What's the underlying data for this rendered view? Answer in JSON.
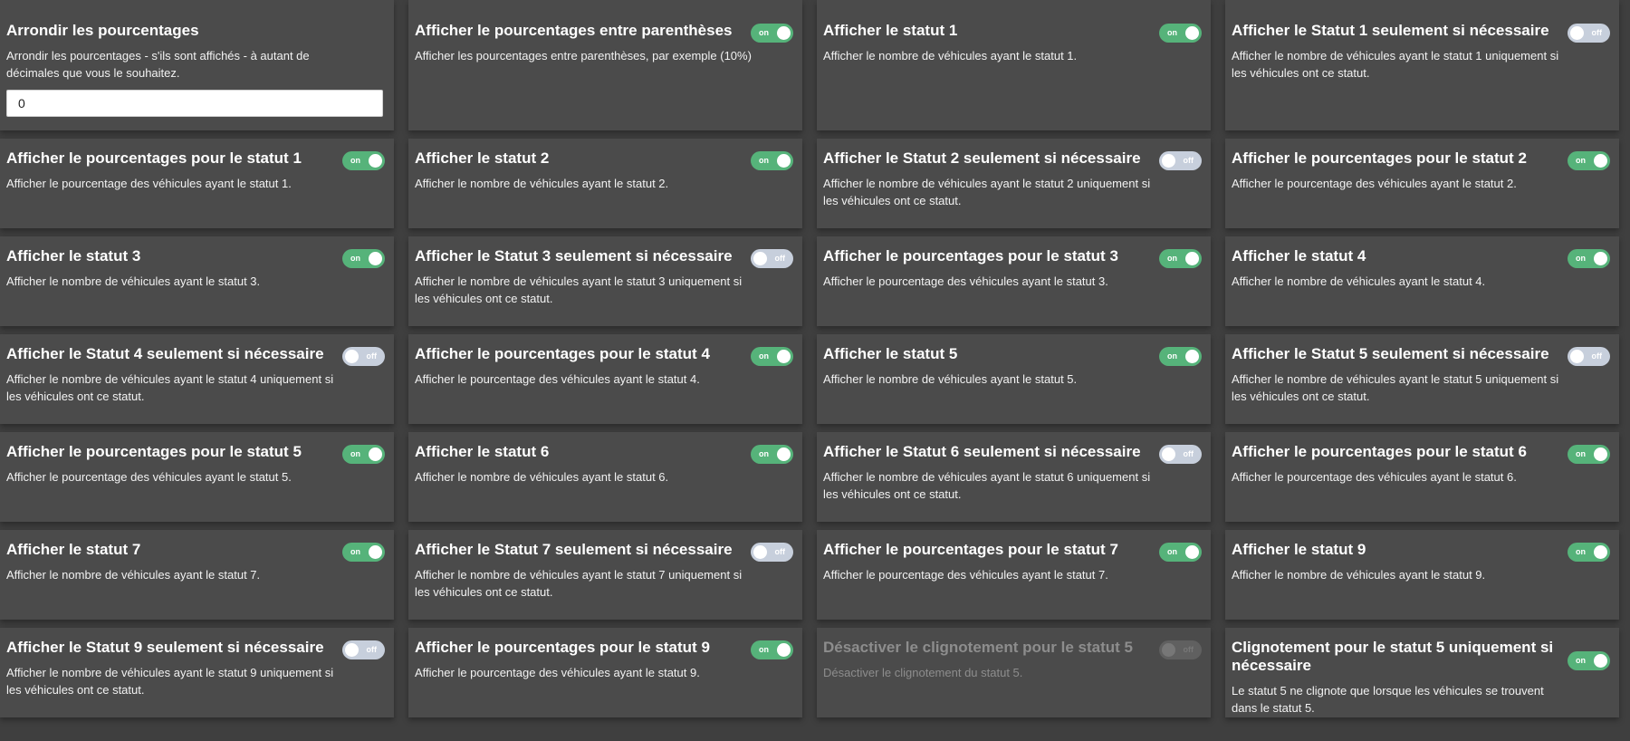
{
  "settings": [
    {
      "title": "Arrondir les pourcentages",
      "desc": "Arrondir les pourcentages - s'ils sont affichés - à autant de décimales que vous le souhaitez.",
      "input_value": "0"
    },
    {
      "title": "Afficher le pourcentages entre parenthèses",
      "desc": "Afficher les pourcentages entre parenthèses, par exemple (10%)",
      "toggle": "on"
    },
    {
      "title": "Afficher le statut 1",
      "desc": "Afficher le nombre de véhicules ayant le statut 1.",
      "toggle": "on"
    },
    {
      "title": "Afficher le Statut 1 seulement si nécessaire",
      "desc": "Afficher le nombre de véhicules ayant le statut 1 uniquement si les véhicules ont ce statut.",
      "toggle": "off"
    },
    {
      "title": "Afficher le pourcentages pour le statut 1",
      "desc": "Afficher le pourcentage des véhicules ayant le statut 1.",
      "toggle": "on"
    },
    {
      "title": "Afficher le statut 2",
      "desc": "Afficher le nombre de véhicules ayant le statut 2.",
      "toggle": "on"
    },
    {
      "title": "Afficher le Statut 2 seulement si nécessaire",
      "desc": "Afficher le nombre de véhicules ayant le statut 2 uniquement si les véhicules ont ce statut.",
      "toggle": "off"
    },
    {
      "title": "Afficher le pourcentages pour le statut 2",
      "desc": "Afficher le pourcentage des véhicules ayant le statut 2.",
      "toggle": "on"
    },
    {
      "title": "Afficher le statut 3",
      "desc": "Afficher le nombre de véhicules ayant le statut 3.",
      "toggle": "on"
    },
    {
      "title": "Afficher le Statut 3 seulement si nécessaire",
      "desc": "Afficher le nombre de véhicules ayant le statut 3 uniquement si les véhicules ont ce statut.",
      "toggle": "off"
    },
    {
      "title": "Afficher le pourcentages pour le statut 3",
      "desc": "Afficher le pourcentage des véhicules ayant le statut 3.",
      "toggle": "on"
    },
    {
      "title": "Afficher le statut 4",
      "desc": "Afficher le nombre de véhicules ayant le statut 4.",
      "toggle": "on"
    },
    {
      "title": "Afficher le Statut 4 seulement si nécessaire",
      "desc": "Afficher le nombre de véhicules ayant le statut 4 uniquement si les véhicules ont ce statut.",
      "toggle": "off"
    },
    {
      "title": "Afficher le pourcentages pour le statut 4",
      "desc": "Afficher le pourcentage des véhicules ayant le statut 4.",
      "toggle": "on"
    },
    {
      "title": "Afficher le statut 5",
      "desc": "Afficher le nombre de véhicules ayant le statut 5.",
      "toggle": "on"
    },
    {
      "title": "Afficher le Statut 5 seulement si nécessaire",
      "desc": "Afficher le nombre de véhicules ayant le statut 5 uniquement si les véhicules ont ce statut.",
      "toggle": "off"
    },
    {
      "title": "Afficher le pourcentages pour le statut 5",
      "desc": "Afficher le pourcentage des véhicules ayant le statut 5.",
      "toggle": "on"
    },
    {
      "title": "Afficher le statut 6",
      "desc": "Afficher le nombre de véhicules ayant le statut 6.",
      "toggle": "on"
    },
    {
      "title": "Afficher le Statut 6 seulement si nécessaire",
      "desc": "Afficher le nombre de véhicules ayant le statut 6 uniquement si les véhicules ont ce statut.",
      "toggle": "off"
    },
    {
      "title": "Afficher le pourcentages pour le statut 6",
      "desc": "Afficher le pourcentage des véhicules ayant le statut 6.",
      "toggle": "on"
    },
    {
      "title": "Afficher le statut 7",
      "desc": "Afficher le nombre de véhicules ayant le statut 7.",
      "toggle": "on"
    },
    {
      "title": "Afficher le Statut 7 seulement si nécessaire",
      "desc": "Afficher le nombre de véhicules ayant le statut 7 uniquement si les véhicules ont ce statut.",
      "toggle": "off"
    },
    {
      "title": "Afficher le pourcentages pour le statut 7",
      "desc": "Afficher le pourcentage des véhicules ayant le statut 7.",
      "toggle": "on"
    },
    {
      "title": "Afficher le statut 9",
      "desc": "Afficher le nombre de véhicules ayant le statut 9.",
      "toggle": "on"
    },
    {
      "title": "Afficher le Statut 9 seulement si nécessaire",
      "desc": "Afficher le nombre de véhicules ayant le statut 9 uniquement si les véhicules ont ce statut.",
      "toggle": "off"
    },
    {
      "title": "Afficher le pourcentages pour le statut 9",
      "desc": "Afficher le pourcentage des véhicules ayant le statut 9.",
      "toggle": "on"
    },
    {
      "title": "Désactiver le clignotement pour le statut 5",
      "desc": "Désactiver le clignotement du statut 5.",
      "toggle": "off",
      "disabled": true
    },
    {
      "title": "Clignotement pour le statut 5 uniquement si nécessaire",
      "desc": "Le statut 5 ne clignote que lorsque les véhicules se trouvent dans le statut 5.",
      "toggle": "on"
    }
  ],
  "labels": {
    "on": "on",
    "off": "off"
  },
  "colors": {
    "toggle_on": "#56b37a",
    "toggle_off": "#c7cfdc",
    "card_bg": "#4b4b4b",
    "page_bg": "#3f3f3f"
  }
}
